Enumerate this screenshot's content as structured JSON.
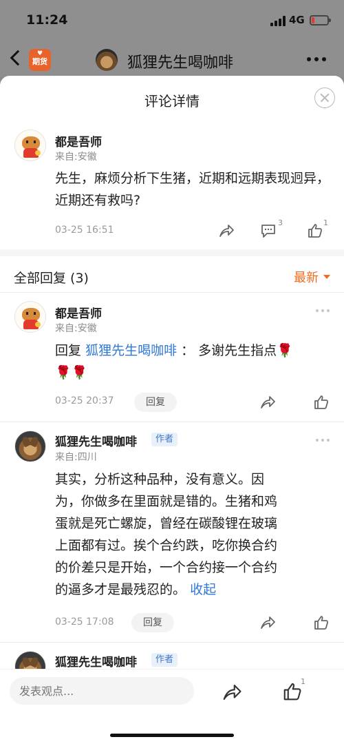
{
  "status_bar": {
    "time": "11:24",
    "network": "4G",
    "battery_level_percent": 18,
    "signal_icon": "signal-bars-icon",
    "battery_icon": "battery-low-icon"
  },
  "header": {
    "back_icon": "back-arrow-icon",
    "app_logo_text": "期货",
    "title": "狐狸先生喝咖啡",
    "more_icon": "more-horizontal-icon"
  },
  "sheet": {
    "title": "评论详情",
    "close_icon": "close-icon"
  },
  "main_comment": {
    "name": "都是吾师",
    "location": "来自:安徽",
    "content": "先生，麻烦分析下生猪，近期和远期表现迥异，近期还有救吗?",
    "time": "03-25 16:51",
    "comment_count": "3",
    "like_count": "1"
  },
  "replies_header": {
    "title": "全部回复 (3)",
    "sort_label": "最新"
  },
  "replies": [
    {
      "name": "都是吾师",
      "location": "来自:安徽",
      "reply_prefix": "回复",
      "mention": "狐狸先生喝咖啡",
      "colon": " ：",
      "content": "多谢先生指点",
      "rose": "🌹",
      "time": "03-25 20:37",
      "reply_button": "回复"
    },
    {
      "name": "狐狸先生喝咖啡",
      "author_tag": "作者",
      "location": "来自:四川",
      "content_lines": [
        "其实，分析这种品种，没有意义。因",
        "为，你做多在里面就是错的。生猪和鸡",
        "蛋就是死亡螺旋，曾经在碳酸锂在玻璃",
        "上面都有过。挨个合约跌，吃你换合约",
        "的价差只是开始，一个合约接一个合约"
      ],
      "last_line": "的逼多才是最残忍的。",
      "collapse_text": "收起",
      "time": "03-25 17:08",
      "reply_button": "回复"
    },
    {
      "name": "狐狸先生喝咖啡",
      "author_tag": "作者"
    }
  ],
  "bottom_bar": {
    "input_placeholder": "发表观点...",
    "share_icon": "share-icon",
    "like_icon": "thumbs-up-icon",
    "like_count": "1"
  },
  "colors": {
    "accent_orange": "#f26b1d",
    "link_blue": "#2f78d6",
    "author_tag_bg": "#e8f0fb"
  }
}
